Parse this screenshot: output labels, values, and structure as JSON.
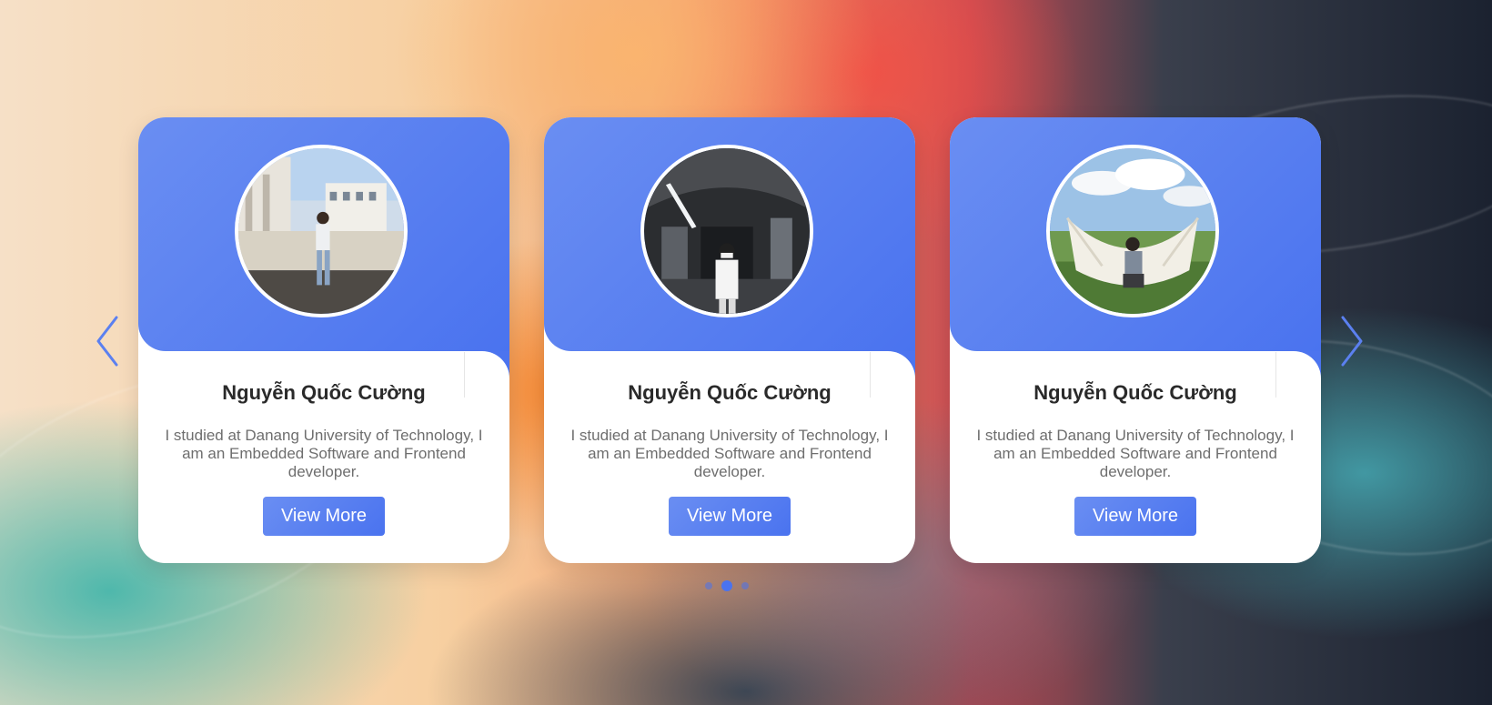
{
  "colors": {
    "accent": "#4a73ef",
    "accent_light": "#6a8ef2",
    "card_bg": "#ffffff",
    "name_text": "#2a2a2a",
    "desc_text": "#6e6e6e"
  },
  "carousel": {
    "prev_icon": "chevron-left-icon",
    "next_icon": "chevron-right-icon",
    "pagination": {
      "count": 3,
      "active_index": 1
    }
  },
  "cards": [
    {
      "name": "Nguyễn Quốc Cường",
      "description": "I studied at Danang University of Technology, I am an Embedded Software and Frontend developer.",
      "button_label": "View More",
      "photo": "avatar-photo-street"
    },
    {
      "name": "Nguyễn Quốc Cường",
      "description": "I studied at Danang University of Technology, I am an Embedded Software and Frontend developer.",
      "button_label": "View More",
      "photo": "avatar-photo-tunnel"
    },
    {
      "name": "Nguyễn Quốc Cường",
      "description": "I studied at Danang University of Technology, I am an Embedded Software and Frontend developer.",
      "button_label": "View More",
      "photo": "avatar-photo-hammock"
    }
  ]
}
